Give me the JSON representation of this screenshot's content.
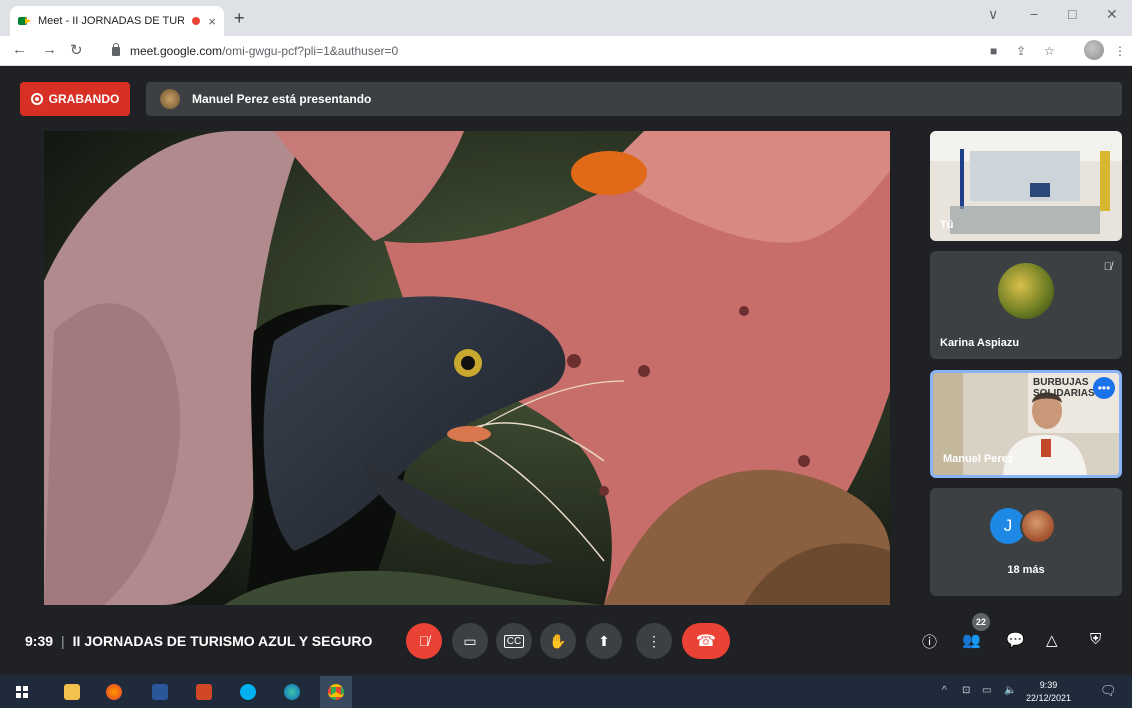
{
  "browser": {
    "tab_title": "Meet - II JORNADAS DE TURI",
    "tab_close": "×",
    "new_tab": "+",
    "url_host": "meet.google.com",
    "url_path": "/omi-gwgu-pcf?pli=1&authuser=0",
    "window_controls": [
      "∨",
      "−",
      "□",
      "✕"
    ]
  },
  "meet": {
    "recording_label": "GRABANDO",
    "presenting_text": "Manuel Perez está presentando",
    "tiles": [
      {
        "name": "Tú"
      },
      {
        "name": "Karina Aspiazu"
      },
      {
        "name": "Manuel Perez",
        "sign_text": "BURBUJAS SOLIDARIAS"
      },
      {
        "avatar_letter": "J",
        "more_text": "18 más"
      }
    ],
    "time": "9:39",
    "separator": "|",
    "meeting_title": "II JORNADAS DE TURISMO AZUL Y SEGURO",
    "participants_count": "22",
    "accent_red": "#ea4335",
    "active_tile_border": "#8ab4f8"
  },
  "taskbar": {
    "time": "9:39",
    "date": "22/12/2021"
  }
}
